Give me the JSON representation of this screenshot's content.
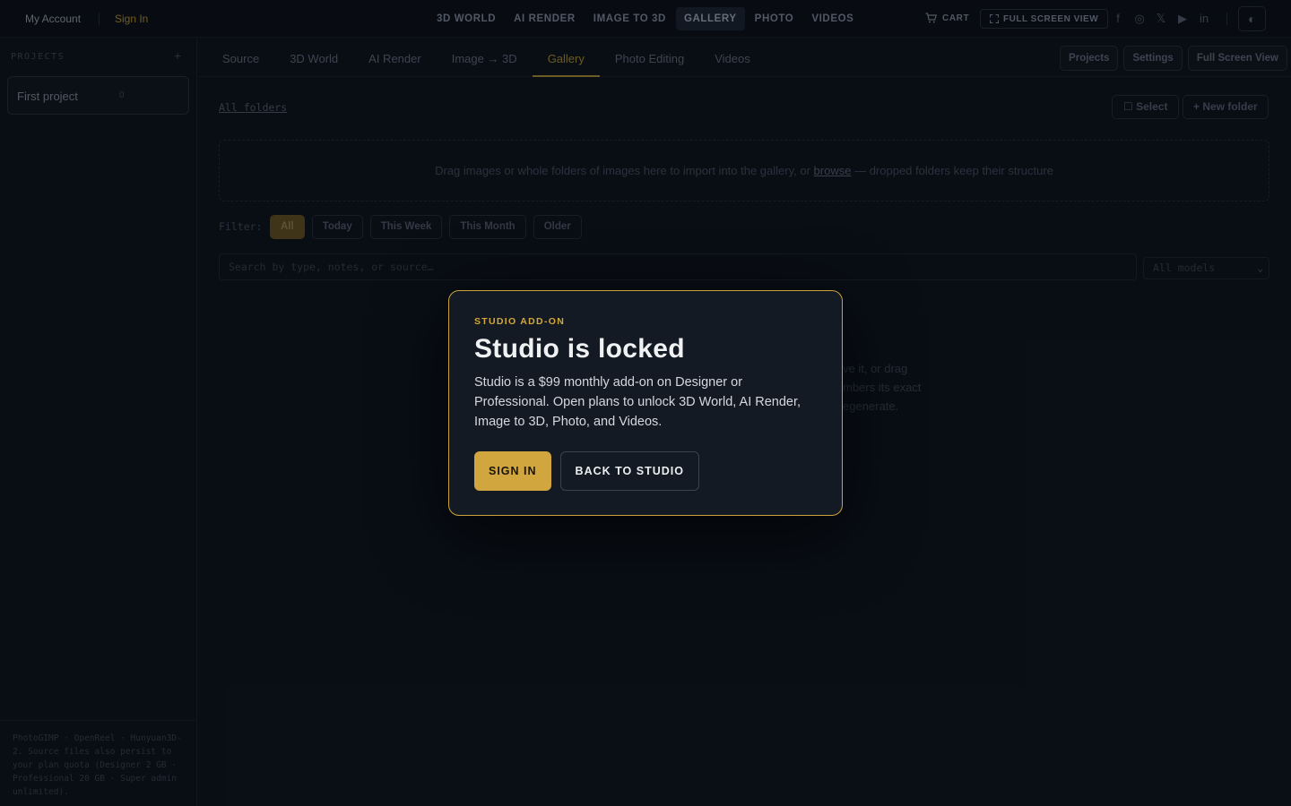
{
  "topbar": {
    "my_account": "My Account",
    "sign_in": "Sign In",
    "nav": [
      "3D WORLD",
      "AI RENDER",
      "IMAGE TO 3D",
      "GALLERY",
      "PHOTO",
      "VIDEOS"
    ],
    "active_nav": "GALLERY",
    "cart": "CART",
    "full_screen_view": "FULL SCREEN VIEW",
    "social_icons": [
      "facebook-icon",
      "instagram-icon",
      "x-icon",
      "youtube-icon",
      "linkedin-icon"
    ],
    "theme_icon": "theme-toggle-icon"
  },
  "sidebar": {
    "label": "PROJECTS",
    "add": "+",
    "project_name": "First project",
    "project_count": "0",
    "footer": "PhotoGIMP · OpenReel · Hunyuan3D-2. Source files also persist to your plan quota (Designer 2 GB · Professional 20 GB · Super admin unlimited)."
  },
  "subnav": {
    "tabs": [
      "Source",
      "3D World",
      "AI Render",
      "Image → 3D",
      "Gallery",
      "Photo Editing",
      "Videos"
    ],
    "active_tab": "Gallery",
    "right_buttons": [
      "Projects",
      "Settings",
      "Full Screen View"
    ]
  },
  "gallery": {
    "all_folders": "All folders",
    "select": "Select",
    "new_folder": "+ New folder",
    "drop_before": "Drag images or whole folders of images here to import into the gallery, or ",
    "drop_link": "browse",
    "drop_after": " — dropped folders keep their structure",
    "filter_label": "Filter:",
    "filters": [
      "All",
      "Today",
      "This Week",
      "This Month",
      "Older"
    ],
    "active_filter": "All",
    "search_placeholder": "Search by type, notes, or source…",
    "model_select": "All models",
    "empty_lines": [
      "ve it, or drag",
      "mbers its exact",
      "egenerate."
    ]
  },
  "modal": {
    "kicker": "STUDIO ADD-ON",
    "title": "Studio is locked",
    "description": "Studio is a $99 monthly add-on on Designer or Professional. Open plans to unlock 3D World, AI Render, Image to 3D, Photo, and Videos.",
    "primary": "SIGN IN",
    "secondary": "BACK TO STUDIO",
    "accent": "#d2a63e"
  }
}
